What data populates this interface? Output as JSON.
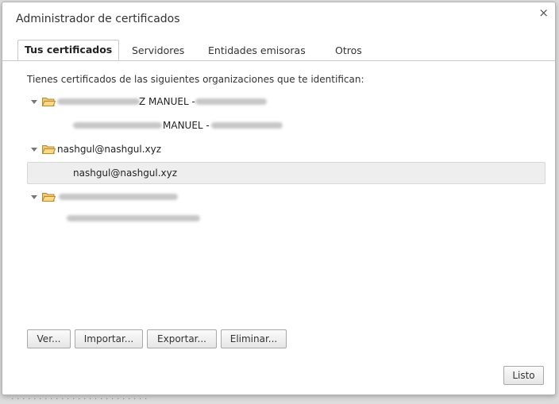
{
  "dialog": {
    "title": "Administrador de certificados",
    "close_symbol": "×"
  },
  "tabs": [
    {
      "label": "Tus certificados",
      "active": true
    },
    {
      "label": "Servidores",
      "active": false
    },
    {
      "label": "Entidades emisoras",
      "active": false
    },
    {
      "label": "Otros",
      "active": false
    }
  ],
  "intro_text": "Tienes certificados de las siguientes organizaciones que te identifican:",
  "tree": {
    "group1": {
      "label_fragment": "Z MANUEL -",
      "child_label_fragment": "MANUEL -",
      "expanded": true
    },
    "group2": {
      "label": "nashgul@nashgul.xyz",
      "child_label": "nashgul@nashgul.xyz",
      "child_selected": true,
      "expanded": true
    },
    "group3": {
      "expanded": true
    }
  },
  "buttons": {
    "view": "Ver...",
    "import": "Importar...",
    "export": "Exportar...",
    "delete": "Eliminar...",
    "done": "Listo"
  },
  "icons": {
    "close": "close-icon",
    "expander": "triangle-down-icon",
    "folder": "folder-open-icon"
  },
  "colors": {
    "folder_fill": "#f3c86a",
    "folder_stroke": "#b9892a",
    "selected_row": "#eeeeee"
  }
}
